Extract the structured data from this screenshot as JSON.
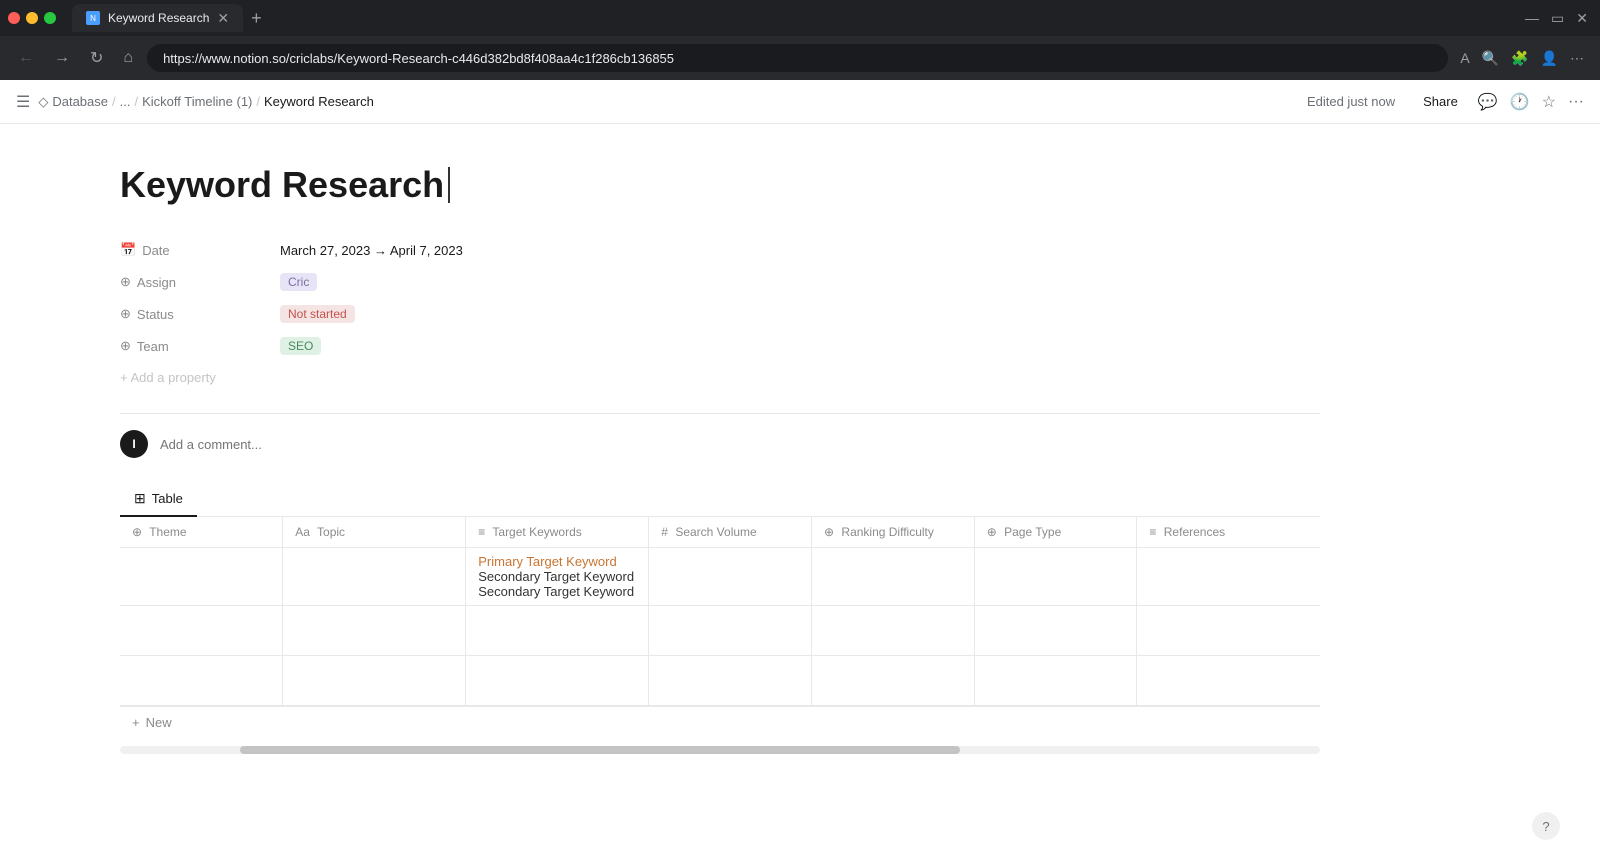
{
  "browser": {
    "tab_title": "Keyword Research",
    "tab_favicon": "N",
    "url": "https://www.notion.so/criclabs/Keyword-Research-c446d382bd8f408aa4c1f286cb136855",
    "new_tab_icon": "+",
    "nav_back": "←",
    "nav_forward": "→",
    "nav_refresh": "↻",
    "nav_home": "⌂"
  },
  "topbar": {
    "menu_icon": "☰",
    "db_icon": "◇",
    "breadcrumb": [
      {
        "label": "Database",
        "sep": "/"
      },
      {
        "label": "...",
        "sep": "/"
      },
      {
        "label": "Kickoff Timeline (1)",
        "sep": "/"
      },
      {
        "label": "Keyword Research",
        "sep": ""
      }
    ],
    "edited_label": "Edited just now",
    "share_label": "Share",
    "comment_icon": "💬",
    "history_icon": "🕐",
    "favorite_icon": "☆",
    "more_icon": "···"
  },
  "page": {
    "title": "Keyword Research",
    "cursor_visible": true,
    "properties": {
      "date": {
        "label": "Date",
        "icon": "📅",
        "value": "March 27, 2023 → April 7, 2023"
      },
      "assign": {
        "label": "Assign",
        "icon": "⊕",
        "value": "Cric",
        "tag_class": "tag-cric"
      },
      "status": {
        "label": "Status",
        "icon": "⊕",
        "value": "Not started",
        "tag_class": "tag-not-started"
      },
      "team": {
        "label": "Team",
        "icon": "⊕",
        "value": "SEO",
        "tag_class": "tag-seo"
      }
    },
    "add_property_label": "+ Add a property",
    "comment_placeholder": "Add a comment...",
    "table_tab_label": "Table",
    "table": {
      "columns": [
        {
          "id": "theme",
          "icon": "⊕",
          "label": "Theme"
        },
        {
          "id": "topic",
          "icon": "Aa",
          "label": "Topic"
        },
        {
          "id": "keywords",
          "icon": "≡",
          "label": "Target Keywords"
        },
        {
          "id": "search_volume",
          "icon": "#",
          "label": "Search Volume"
        },
        {
          "id": "ranking",
          "icon": "⊕",
          "label": "Ranking Difficulty"
        },
        {
          "id": "page_type",
          "icon": "⊕",
          "label": "Page Type"
        },
        {
          "id": "references",
          "icon": "≡",
          "label": "References"
        }
      ],
      "rows": [
        {
          "theme": "",
          "topic": "",
          "keywords": [
            {
              "text": "Primary Target Keyword",
              "type": "primary"
            },
            {
              "text": "Secondary Target Keyword",
              "type": "secondary"
            },
            {
              "text": "Secondary Target Keyword",
              "type": "secondary"
            }
          ],
          "search_volume": "",
          "ranking": "",
          "page_type": "",
          "references": ""
        },
        {
          "theme": "",
          "topic": "",
          "keywords": [],
          "search_volume": "",
          "ranking": "",
          "page_type": "",
          "references": ""
        },
        {
          "theme": "",
          "topic": "",
          "keywords": [],
          "search_volume": "",
          "ranking": "",
          "page_type": "",
          "references": ""
        }
      ],
      "new_row_label": "New"
    }
  },
  "help": {
    "label": "?"
  }
}
